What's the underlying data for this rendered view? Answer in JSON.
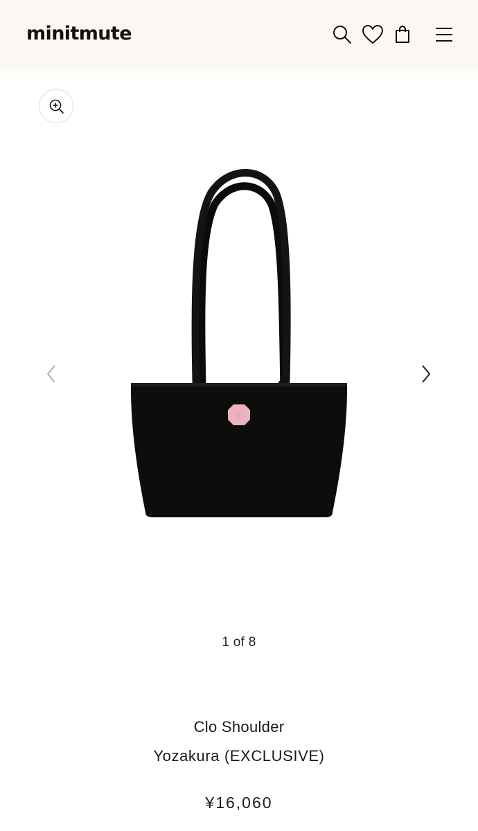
{
  "header": {
    "logo": "minitmute",
    "icons": [
      "search-icon",
      "heart-icon",
      "bag-icon",
      "menu-icon"
    ]
  },
  "gallery": {
    "zoom_icon": "zoom-in-icon",
    "prev_icon": "chevron-left-icon",
    "next_icon": "chevron-right-icon",
    "counter": "1 of 8",
    "product_image": "black tote bag with pink octagon badge"
  },
  "product": {
    "name": "Clo Shoulder",
    "variant": "Yozakura (EXCLUSIVE)",
    "price": "¥16,060"
  },
  "colors": {
    "header_bg": "#fbf8f3",
    "text": "#1a1a1a",
    "bag": "#0d0d0d",
    "badge": "#eab3bd"
  }
}
